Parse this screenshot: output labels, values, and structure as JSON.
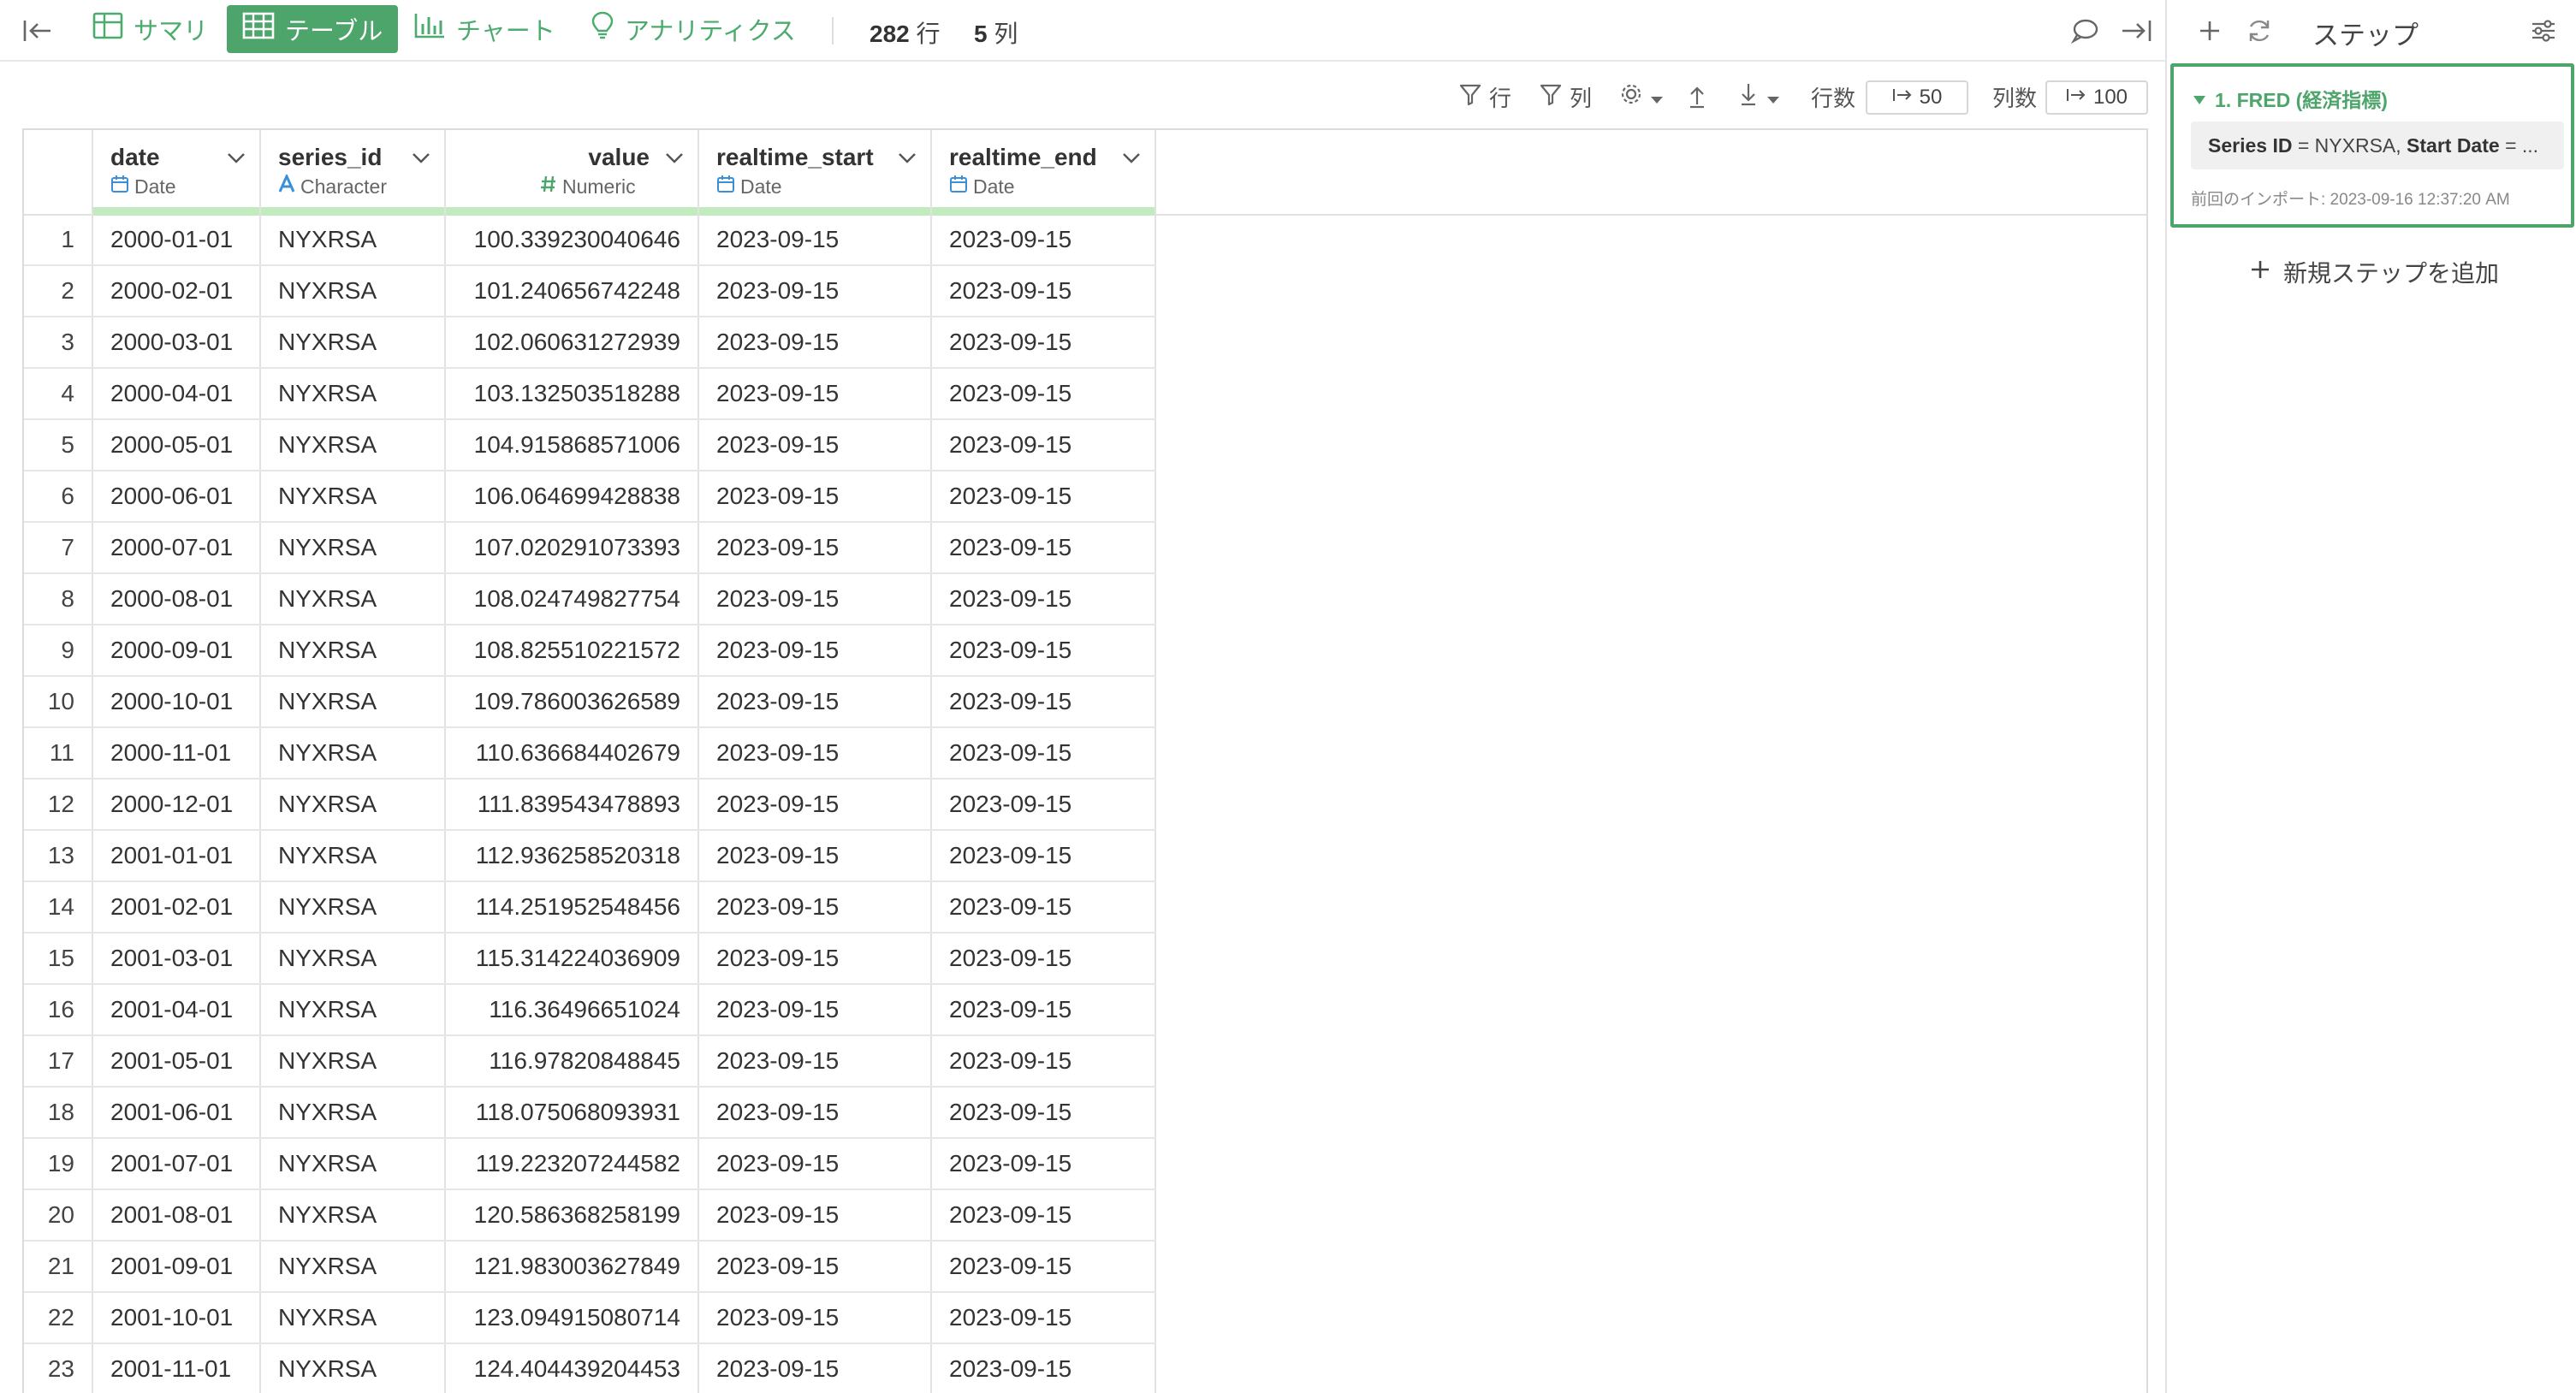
{
  "toolbar": {
    "tabs": [
      {
        "label": "サマリ"
      },
      {
        "label": "テーブル"
      },
      {
        "label": "チャート"
      },
      {
        "label": "アナリティクス"
      }
    ],
    "row_count": "282",
    "row_unit": "行",
    "col_count": "5",
    "col_unit": "列"
  },
  "subbar": {
    "filter_rows": "行",
    "filter_cols": "列",
    "rows_label": "行数",
    "rows_value": "50",
    "cols_label": "列数",
    "cols_value": "100"
  },
  "table": {
    "columns": [
      {
        "name": "date",
        "type": "Date"
      },
      {
        "name": "series_id",
        "type": "Character"
      },
      {
        "name": "value",
        "type": "Numeric"
      },
      {
        "name": "realtime_start",
        "type": "Date"
      },
      {
        "name": "realtime_end",
        "type": "Date"
      }
    ],
    "rows": [
      [
        "1",
        "2000-01-01",
        "NYXRSA",
        "100.339230040646",
        "2023-09-15",
        "2023-09-15"
      ],
      [
        "2",
        "2000-02-01",
        "NYXRSA",
        "101.240656742248",
        "2023-09-15",
        "2023-09-15"
      ],
      [
        "3",
        "2000-03-01",
        "NYXRSA",
        "102.060631272939",
        "2023-09-15",
        "2023-09-15"
      ],
      [
        "4",
        "2000-04-01",
        "NYXRSA",
        "103.132503518288",
        "2023-09-15",
        "2023-09-15"
      ],
      [
        "5",
        "2000-05-01",
        "NYXRSA",
        "104.915868571006",
        "2023-09-15",
        "2023-09-15"
      ],
      [
        "6",
        "2000-06-01",
        "NYXRSA",
        "106.064699428838",
        "2023-09-15",
        "2023-09-15"
      ],
      [
        "7",
        "2000-07-01",
        "NYXRSA",
        "107.020291073393",
        "2023-09-15",
        "2023-09-15"
      ],
      [
        "8",
        "2000-08-01",
        "NYXRSA",
        "108.024749827754",
        "2023-09-15",
        "2023-09-15"
      ],
      [
        "9",
        "2000-09-01",
        "NYXRSA",
        "108.825510221572",
        "2023-09-15",
        "2023-09-15"
      ],
      [
        "10",
        "2000-10-01",
        "NYXRSA",
        "109.786003626589",
        "2023-09-15",
        "2023-09-15"
      ],
      [
        "11",
        "2000-11-01",
        "NYXRSA",
        "110.636684402679",
        "2023-09-15",
        "2023-09-15"
      ],
      [
        "12",
        "2000-12-01",
        "NYXRSA",
        "111.839543478893",
        "2023-09-15",
        "2023-09-15"
      ],
      [
        "13",
        "2001-01-01",
        "NYXRSA",
        "112.936258520318",
        "2023-09-15",
        "2023-09-15"
      ],
      [
        "14",
        "2001-02-01",
        "NYXRSA",
        "114.251952548456",
        "2023-09-15",
        "2023-09-15"
      ],
      [
        "15",
        "2001-03-01",
        "NYXRSA",
        "115.314224036909",
        "2023-09-15",
        "2023-09-15"
      ],
      [
        "16",
        "2001-04-01",
        "NYXRSA",
        "116.36496651024",
        "2023-09-15",
        "2023-09-15"
      ],
      [
        "17",
        "2001-05-01",
        "NYXRSA",
        "116.97820848845",
        "2023-09-15",
        "2023-09-15"
      ],
      [
        "18",
        "2001-06-01",
        "NYXRSA",
        "118.075068093931",
        "2023-09-15",
        "2023-09-15"
      ],
      [
        "19",
        "2001-07-01",
        "NYXRSA",
        "119.223207244582",
        "2023-09-15",
        "2023-09-15"
      ],
      [
        "20",
        "2001-08-01",
        "NYXRSA",
        "120.586368258199",
        "2023-09-15",
        "2023-09-15"
      ],
      [
        "21",
        "2001-09-01",
        "NYXRSA",
        "121.983003627849",
        "2023-09-15",
        "2023-09-15"
      ],
      [
        "22",
        "2001-10-01",
        "NYXRSA",
        "123.094915080714",
        "2023-09-15",
        "2023-09-15"
      ],
      [
        "23",
        "2001-11-01",
        "NYXRSA",
        "124.404439204453",
        "2023-09-15",
        "2023-09-15"
      ]
    ]
  },
  "panel": {
    "title": "ステップ",
    "step": {
      "title": "1. FRED (経済指標)",
      "param1_key": "Series ID",
      "param1_value": "= NYXRSA,",
      "param2_key": "Start Date",
      "param2_value": "= ...",
      "meta": "前回のインポート: 2023-09-16 12:37:20 AM"
    },
    "add_step_label": "新規ステップを追加"
  },
  "colors": {
    "accent": "#4ea56b",
    "type_icon_blue": "#3b8fd9",
    "type_icon_green": "#4ea56b",
    "quality_band": "#c3ebc0"
  },
  "icons": [
    "collapse-left-icon",
    "grid-icon",
    "table-icon",
    "bar-chart-icon",
    "lightbulb-icon",
    "comment-icon",
    "expand-right-icon",
    "filter-icon",
    "gear-icon",
    "caret-down-icon",
    "upload-icon",
    "download-icon",
    "arrow-bar-right-icon",
    "plus-icon",
    "refresh-icon",
    "sliders-icon",
    "calendar-icon",
    "character-a-icon",
    "hash-icon",
    "triangle-down-icon"
  ]
}
